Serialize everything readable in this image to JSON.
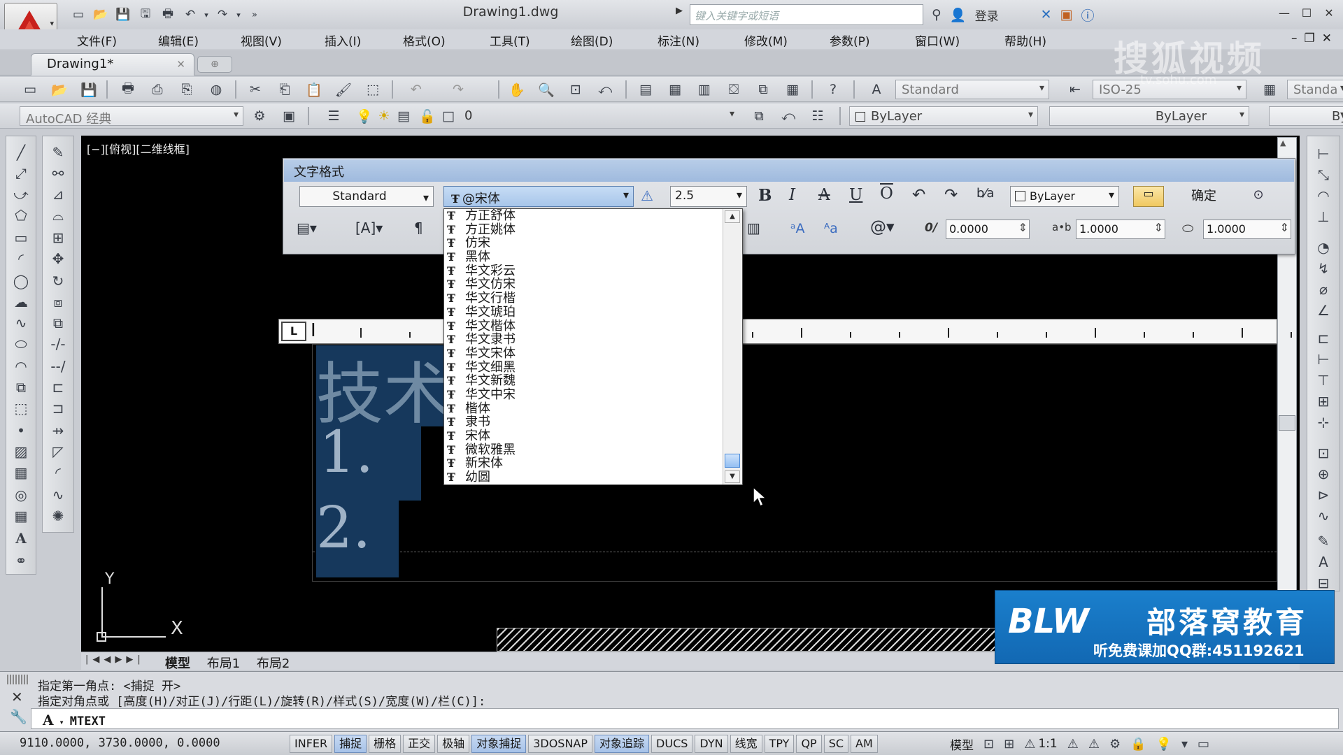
{
  "title_bar": {
    "document_title": "Drawing1.dwg",
    "search_placeholder": "键入关键字或短语",
    "login_label": "登录",
    "quick_access_icons": [
      "new-icon",
      "open-icon",
      "save-icon",
      "save-as-icon",
      "plot-icon",
      "undo-icon",
      "redo-icon",
      "more-icon"
    ]
  },
  "menubar": {
    "items": [
      "文件(F)",
      "编辑(E)",
      "视图(V)",
      "插入(I)",
      "格式(O)",
      "工具(T)",
      "绘图(D)",
      "标注(N)",
      "修改(M)",
      "参数(P)",
      "窗口(W)",
      "帮助(H)"
    ]
  },
  "watermark": {
    "logo_text": "搜狐视频",
    "url_text": "tv.sohu.com"
  },
  "doc_tabs": {
    "active": "Drawing1*"
  },
  "toolbar_standard": {
    "text_style": "Standard",
    "dim_style": "ISO-25",
    "table_style": "Standa"
  },
  "toolbar_layers": {
    "workspace": "AutoCAD 经典",
    "layer_value": "0",
    "color": "ByLayer",
    "linetype": "ByLayer",
    "lineweight": "By"
  },
  "viewport": {
    "label": "[−][俯视][二维线框]"
  },
  "text_formatting": {
    "title": "文字格式",
    "style": "Standard",
    "font": "@宋体",
    "height": "2.5",
    "color": "ByLayer",
    "ok_label": "确定",
    "oblique_angle": "0.0000",
    "tracking": "1.0000",
    "width_factor": "1.0000"
  },
  "font_list": {
    "items": [
      "方正舒体",
      "方正姚体",
      "仿宋",
      "黑体",
      "华文彩云",
      "华文仿宋",
      "华文行楷",
      "华文琥珀",
      "华文楷体",
      "华文隶书",
      "华文宋体",
      "华文细黑",
      "华文新魏",
      "华文中宋",
      "楷体",
      "隶书",
      "宋体",
      "微软雅黑",
      "新宋体",
      "幼圆"
    ]
  },
  "mtext_content": {
    "line0": "技术",
    "line1": "1.",
    "line2": "2."
  },
  "ucs": {
    "x_label": "X",
    "y_label": "Y"
  },
  "layout_tabs": {
    "items": [
      "模型",
      "布局1",
      "布局2"
    ]
  },
  "brand": {
    "mark": "BLW",
    "name": "部落窝教育",
    "subtitle": "听免费课加QQ群:451192621"
  },
  "command_line": {
    "history_1": "指定第一角点:  <捕捉 开>",
    "history_2": "指定对角点或 [高度(H)/对正(J)/行距(L)/旋转(R)/样式(S)/宽度(W)/栏(C)]:",
    "current": "MTEXT"
  },
  "status_bar": {
    "coords": "9110.0000, 3730.0000, 0.0000",
    "buttons": [
      {
        "label": "INFER",
        "on": false
      },
      {
        "label": "捕捉",
        "on": true
      },
      {
        "label": "栅格",
        "on": false
      },
      {
        "label": "正交",
        "on": false
      },
      {
        "label": "极轴",
        "on": false
      },
      {
        "label": "对象捕捉",
        "on": true
      },
      {
        "label": "3DOSNAP",
        "on": false
      },
      {
        "label": "对象追踪",
        "on": true
      },
      {
        "label": "DUCS",
        "on": false
      },
      {
        "label": "DYN",
        "on": false
      },
      {
        "label": "线宽",
        "on": false
      },
      {
        "label": "TPY",
        "on": false
      },
      {
        "label": "QP",
        "on": false
      },
      {
        "label": "SC",
        "on": false
      },
      {
        "label": "AM",
        "on": false
      }
    ],
    "model_label": "模型",
    "annotation_scale": "1:1"
  }
}
